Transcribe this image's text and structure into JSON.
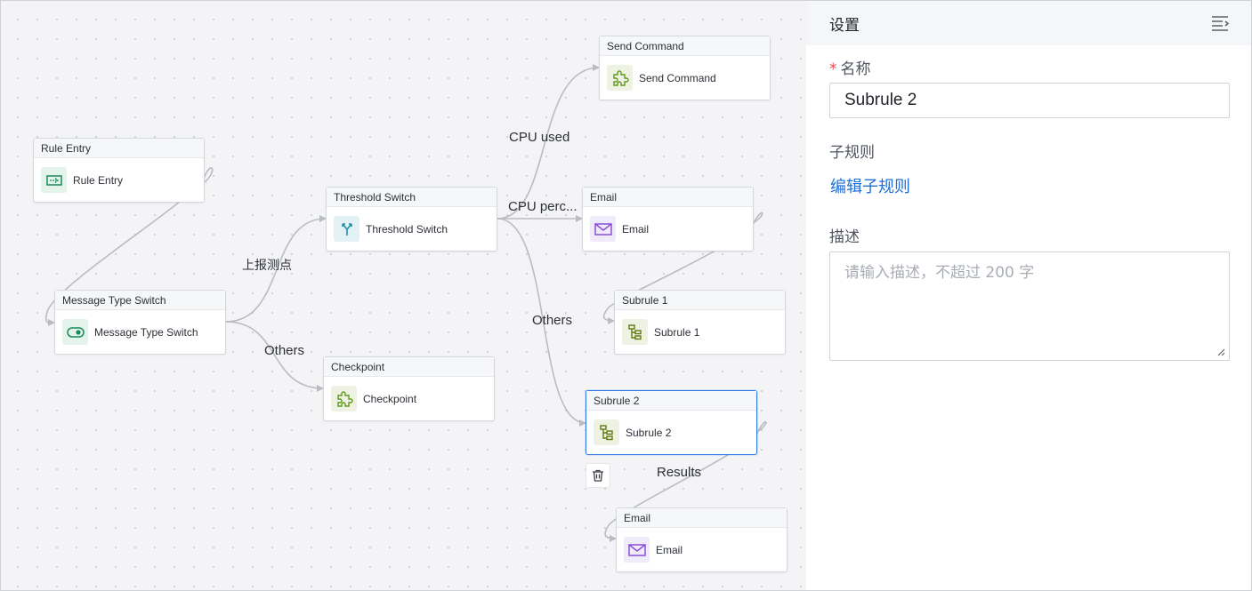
{
  "canvas": {
    "nodes": [
      {
        "id": "rule-entry",
        "header": "Rule Entry",
        "label": "Rule Entry",
        "icon": "rule-entry-icon",
        "selected": false
      },
      {
        "id": "message-type-switch",
        "header": "Message Type Switch",
        "label": "Message Type Switch",
        "icon": "toggle-switch-icon",
        "selected": false
      },
      {
        "id": "threshold-switch",
        "header": "Threshold Switch",
        "label": "Threshold Switch",
        "icon": "fork-icon",
        "selected": false
      },
      {
        "id": "checkpoint",
        "header": "Checkpoint",
        "label": "Checkpoint",
        "icon": "puzzle-icon",
        "selected": false
      },
      {
        "id": "send-command",
        "header": "Send Command",
        "label": "Send Command",
        "icon": "puzzle-icon",
        "selected": false
      },
      {
        "id": "email-1",
        "header": "Email",
        "label": "Email",
        "icon": "envelope-icon",
        "selected": false
      },
      {
        "id": "subrule-1",
        "header": "Subrule 1",
        "label": "Subrule 1",
        "icon": "tree-icon",
        "selected": false
      },
      {
        "id": "subrule-2",
        "header": "Subrule 2",
        "label": "Subrule 2",
        "icon": "tree-icon",
        "selected": true
      },
      {
        "id": "email-2",
        "header": "Email",
        "label": "Email",
        "icon": "envelope-icon",
        "selected": false
      }
    ],
    "edge_labels": {
      "report_points": "上报测点",
      "others_1": "Others",
      "cpu_used": "CPU used",
      "cpu_perc": "CPU perc...",
      "others_2": "Others",
      "results": "Results"
    },
    "colors": {
      "edge": "#b9bcc3",
      "selected_border": "#2f7ae5"
    }
  },
  "panel": {
    "title": "设置",
    "name_label": "名称",
    "required_mark": "*",
    "name_value": "Subrule 2",
    "subrule_label": "子规则",
    "edit_subrule_link": "编辑子规则",
    "description_label": "描述",
    "description_placeholder": "请输入描述，不超过 200 字",
    "link_color": "#1f6fd8"
  }
}
